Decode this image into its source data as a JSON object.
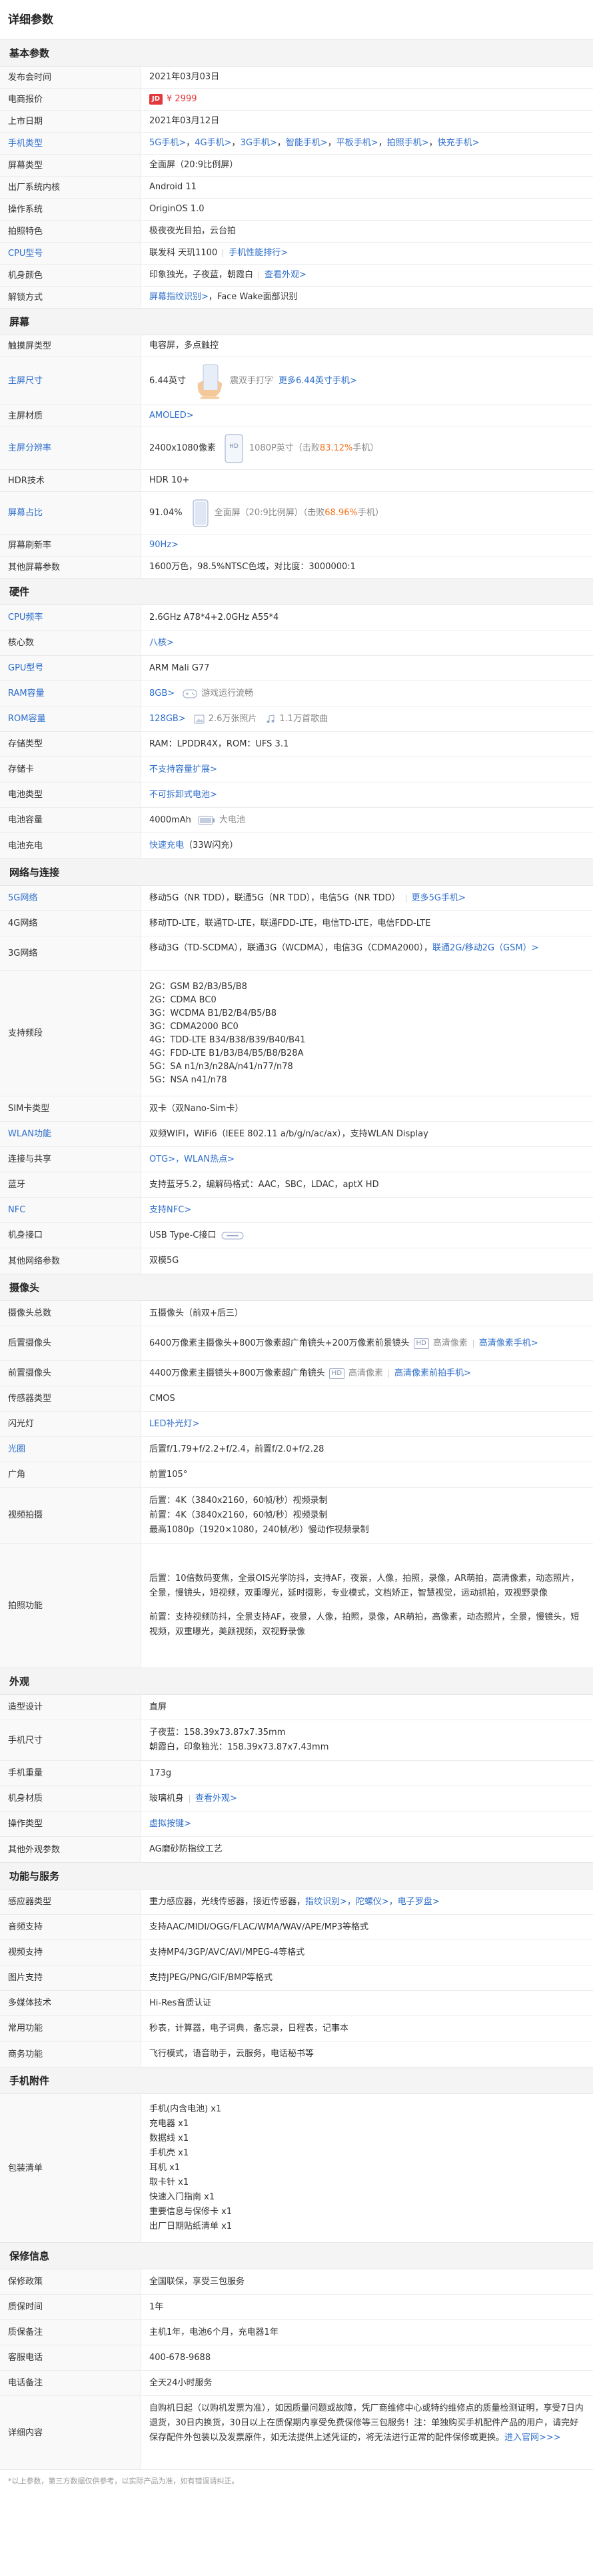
{
  "title": "详细参数",
  "basic": {
    "h": "基本参数",
    "r1k": "发布会时间",
    "r1v": "2021年03月03日",
    "r2k": "电商报价",
    "r2jd": "JD",
    "r2v": "¥ 2999",
    "r3k": "上市日期",
    "r3v": "2021年03月12日",
    "r4k": "手机类型",
    "r4v": [
      "5G手机",
      "4G手机",
      "3G手机",
      "智能手机",
      "平板手机",
      "拍照手机",
      "快充手机"
    ],
    "r4gt": ">",
    "r5k": "屏幕类型",
    "r5v": "全面屏（20:9比例屏）",
    "r6k": "出厂系统内核",
    "r6v": "Android 11",
    "r7k": "操作系统",
    "r7v": "OriginOS 1.0",
    "r8k": "拍照特色",
    "r8v": "极夜夜光目拍，云台拍",
    "r9k": "CPU型号",
    "r9v1": "联发科 天玑1100",
    "r9v2": "手机性能排行>",
    "r10k": "机身颜色",
    "r10v1": "印象独光，子夜蓝，朝霞白",
    "r10v2": "查看外观>",
    "r11k": "解锁方式",
    "r11v1": "屏幕指纹识别>",
    "r11v2": "，Face Wake面部识别"
  },
  "screen": {
    "h": "屏幕",
    "r1k": "触摸屏类型",
    "r1v": "电容屏，多点触控",
    "r2k": "主屏尺寸",
    "r2v": "6.44英寸",
    "r2g": "震双手打字",
    "r2a": "更多6.44英寸手机>",
    "r3k": "主屏材质",
    "r3v": "AMOLED>",
    "r4k": "主屏分辨率",
    "r4v": "2400x1080像素",
    "r4hd": "HD",
    "r4g1": "1080P英寸（击败",
    "r4o": "83.12%",
    "r4g2": "手机）",
    "r5k": "HDR技术",
    "r5v": "HDR 10+",
    "r6k": "屏幕占比",
    "r6v": "91.04%",
    "r6g1": "全面屏（20:9比例屏）（击败",
    "r6o": "68.96%",
    "r6g2": "手机）",
    "r7k": "屏幕刷新率",
    "r7v": "90Hz>",
    "r8k": "其他屏幕参数",
    "r8v": "1600万色，98.5%NTSC色域，对比度：3000000:1"
  },
  "hardware": {
    "h": "硬件",
    "r1k": "CPU频率",
    "r1v": "2.6GHz A78*4+2.0GHz A55*4",
    "r2k": "核心数",
    "r2v": "八核>",
    "r3k": "GPU型号",
    "r3v": "ARM Mali G77",
    "r4k": "RAM容量",
    "r4v": "8GB>",
    "r4g": "游戏运行流畅",
    "r5k": "ROM容量",
    "r5v": "128GB>",
    "r5g1": "2.6万张照片",
    "r5g2": "1.1万首歌曲",
    "r6k": "存储类型",
    "r6v": "RAM：LPDDR4X，ROM：UFS 3.1",
    "r7k": "存储卡",
    "r7v": "不支持容量扩展>",
    "r8k": "电池类型",
    "r8v": "不可拆卸式电池>",
    "r9k": "电池容量",
    "r9v": "4000mAh",
    "r9g": "大电池",
    "r10k": "电池充电",
    "r10v1": "快速充电",
    "r10v2": "（33W闪充）"
  },
  "network": {
    "h": "网络与连接",
    "r1k": "5G网络",
    "r1v": "移动5G（NR TDD），联通5G（NR TDD），电信5G（NR TDD）",
    "r1a": "更多5G手机>",
    "r2k": "4G网络",
    "r2v": "移动TD-LTE，联通TD-LTE，联通FDD-LTE，电信TD-LTE，电信FDD-LTE",
    "r3k": "3G网络",
    "r3v": "移动3G（TD-SCDMA），联通3G（WCDMA），电信3G（CDMA2000），",
    "r3a": "联通2G/移动2G（GSM）>",
    "r4k": "支持频段",
    "r4v": [
      "2G：GSM B2/B3/B5/B8",
      "2G：CDMA BC0",
      "3G：WCDMA B1/B2/B4/B5/B8",
      "3G：CDMA2000 BC0",
      "4G：TDD-LTE B34/B38/B39/B40/B41",
      "4G：FDD-LTE B1/B3/B4/B5/B8/B28A",
      "5G：SA n1/n3/n28A/n41/n77/n78",
      "5G：NSA n41/n78"
    ],
    "r5k": "SIM卡类型",
    "r5v": "双卡（双Nano-Sim卡）",
    "r6k": "WLAN功能",
    "r6v": "双频WIFI，WiFi6（IEEE 802.11 a/b/g/n/ac/ax），支持WLAN Display",
    "r7k": "连接与共享",
    "r7v": "OTG>，WLAN热点>",
    "r8k": "蓝牙",
    "r8v": "支持蓝牙5.2，编解码格式：AAC，SBC，LDAC，aptX HD",
    "r9k": "NFC",
    "r9v": "支持NFC>",
    "r10k": "机身接口",
    "r10v": "USB Type-C接口",
    "r11k": "其他网络参数",
    "r11v": "双模5G"
  },
  "camera": {
    "h": "摄像头",
    "r1k": "摄像头总数",
    "r1v": "五摄像头（前双+后三）",
    "r2k": "后置摄像头",
    "r2v": "6400万像素主摄像头+800万像素超广角镜头+200万像素前景镜头",
    "r2hd": "HD",
    "r2g": "高清像素",
    "r2a": "高清像素手机>",
    "r3k": "前置摄像头",
    "r3v": "4400万像素主摄镜头+800万像素超广角镜头",
    "r3hd": "HD",
    "r3g": "高清像素",
    "r3a": "高清像素前拍手机>",
    "r4k": "传感器类型",
    "r4v": "CMOS",
    "r5k": "闪光灯",
    "r5v": "LED补光灯>",
    "r6k": "光圈",
    "r6v": "后置f/1.79+f/2.2+f/2.4，前置f/2.0+f/2.28",
    "r7k": "广角",
    "r7v": "前置105°",
    "r8k": "视频拍摄",
    "r8v": [
      "后置：4K（3840x2160，60帧/秒）视频录制",
      "前置：4K（3840x2160，60帧/秒）视频录制",
      "最高1080p（1920×1080，240帧/秒）慢动作视频录制"
    ],
    "r9k": "拍照功能",
    "r9v1": "后置：10倍数码变焦，全景OIS光学防抖，支持AF，夜景，人像，拍照，录像，AR萌拍，高清像素，动态照片，全景，慢镜头，短视频，双重曝光，延时摄影，专业模式，文档矫正，智慧视觉，运动抓拍，双视野录像",
    "r9v2": "前置：支持视频防抖，全景支持AF，夜景，人像，拍照，录像，AR萌拍，高像素，动态照片，全景，慢镜头，短视频，双重曝光，美颜视频，双视野录像"
  },
  "look": {
    "h": "外观",
    "r1k": "造型设计",
    "r1v": "直屏",
    "r2k": "手机尺寸",
    "r2v": [
      "子夜蓝：158.39x73.87x7.35mm",
      "朝霞白，印象独光：158.39x73.87x7.43mm"
    ],
    "r3k": "手机重量",
    "r3v": "173g",
    "r4k": "机身材质",
    "r4v1": "玻璃机身",
    "r4v2": "查看外观>",
    "r5k": "操作类型",
    "r5v": "虚拟按键>",
    "r6k": "其他外观参数",
    "r6v": "AG磨砂防指纹工艺"
  },
  "func": {
    "h": "功能与服务",
    "r1k": "感应器类型",
    "r1v1": "重力感应器，光线传感器，接近传感器，",
    "r1v2": "指纹识别>，陀螺仪>，电子罗盘>",
    "r2k": "音频支持",
    "r2v": "支持AAC/MIDI/OGG/FLAC/WMA/WAV/APE/MP3等格式",
    "r3k": "视频支持",
    "r3v": "支持MP4/3GP/AVC/AVI/MPEG-4等格式",
    "r4k": "图片支持",
    "r4v": "支持JPEG/PNG/GIF/BMP等格式",
    "r5k": "多媒体技术",
    "r5v": "Hi-Res音质认证",
    "r6k": "常用功能",
    "r6v": "秒表，计算器，电子词典，备忘录，日程表，记事本",
    "r7k": "商务功能",
    "r7v": "飞行模式，语音助手，云服务，电话秘书等"
  },
  "parts": {
    "h": "手机附件",
    "r1k": "包装清单",
    "r1v": [
      "手机(内含电池) x1",
      "充电器 x1",
      "数据线 x1",
      "手机壳 x1",
      "耳机 x1",
      "取卡针 x1",
      "快速入门指南 x1",
      "重要信息与保修卡 x1",
      "出厂日期贴纸清单 x1"
    ]
  },
  "warranty": {
    "h": "保修信息",
    "r1k": "保修政策",
    "r1v": "全国联保，享受三包服务",
    "r2k": "质保时间",
    "r2v": "1年",
    "r3k": "质保备注",
    "r3v": "主机1年，电池6个月，充电器1年",
    "r4k": "客服电话",
    "r4v": "400-678-9688",
    "r5k": "电话备注",
    "r5v": "全天24小时服务",
    "r6k": "详细内容",
    "r6v": "自购机日起（以购机发票为准），如因质量问题或故障，凭厂商维修中心或特约维修点的质量检测证明，享受7日内退货，30日内换货，30日以上在质保期内享受免费保修等三包服务！注：单独购买手机配件产品的用户，请完好保存配件外包装以及发票原件，如无法提供上述凭证的，将无法进行正常的配件保修或更换。",
    "r6a": "进入官网>>>"
  },
  "footnote": "*以上参数，第三方数据仅供参考，以实际产品为准，如有错误请纠正。",
  "colors": {
    "link": "#2f6fcb",
    "price": "#e4393c",
    "highlight": "#f37421"
  }
}
